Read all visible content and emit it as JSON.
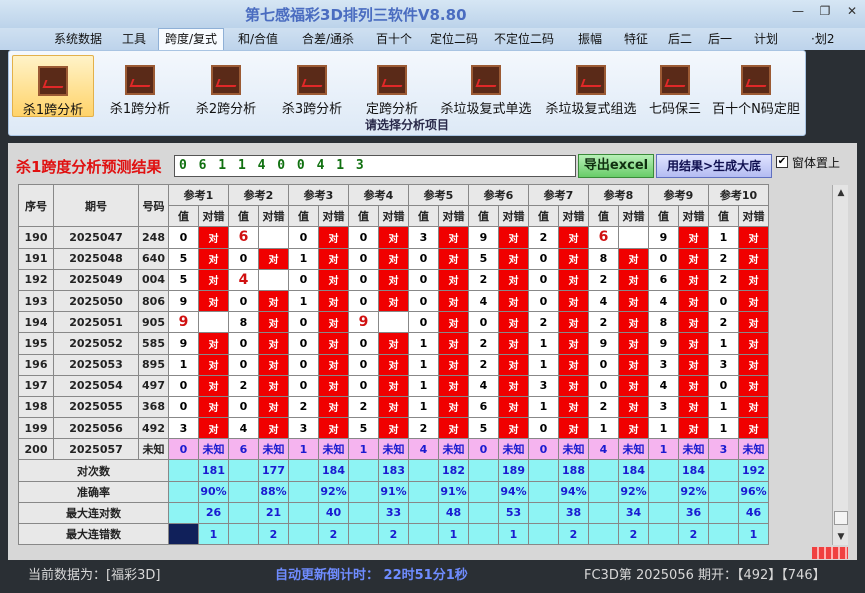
{
  "window": {
    "title": "第七感福彩3D排列三软件V8.80",
    "minimize": "—",
    "restore": "❐",
    "close": "✕"
  },
  "menu": [
    "系统数据",
    "工具",
    "跨度/复式",
    "和/合值",
    "合差/通杀",
    "百十个",
    "定位二码",
    "不定位二码",
    "振幅",
    "特征",
    "后二",
    "后一",
    "计划",
    "·划2"
  ],
  "active_menu": 2,
  "ribbon": {
    "buttons": [
      "杀1跨分析",
      "杀1跨分析",
      "杀2跨分析",
      "杀3跨分析",
      "定跨分析",
      "杀垃圾复式单选",
      "杀垃圾复式组选",
      "七码保三",
      "百十个N码定胆"
    ],
    "active": 0,
    "caption": "请选择分析项目"
  },
  "panel": {
    "title": "杀1跨度分析预测结果",
    "result": "0 6 1 1 4 0 0 4 1 3",
    "export": "导出excel",
    "generate": "用结果>生成大底",
    "pin_label": "窗体置上",
    "pin_checked": "✔"
  },
  "table": {
    "headers": {
      "seq": "序号",
      "issue": "期号",
      "code": "号码",
      "value": "值",
      "check": "对错"
    },
    "refs": [
      "参考1",
      "参考2",
      "参考3",
      "参考4",
      "参考5",
      "参考6",
      "参考7",
      "参考8",
      "参考9",
      "参考10"
    ],
    "rows": [
      {
        "seq": "190",
        "issue": "2025047",
        "code": "248",
        "vals": [
          "0",
          "6",
          "0",
          "0",
          "3",
          "9",
          "2",
          "6",
          "9",
          "1"
        ],
        "ok": [
          1,
          0,
          1,
          1,
          1,
          1,
          1,
          0,
          1,
          1
        ]
      },
      {
        "seq": "191",
        "issue": "2025048",
        "code": "640",
        "vals": [
          "5",
          "0",
          "1",
          "0",
          "0",
          "5",
          "0",
          "8",
          "0",
          "2"
        ],
        "ok": [
          1,
          1,
          1,
          1,
          1,
          1,
          1,
          1,
          1,
          1
        ]
      },
      {
        "seq": "192",
        "issue": "2025049",
        "code": "004",
        "vals": [
          "5",
          "4",
          "0",
          "0",
          "0",
          "2",
          "0",
          "2",
          "6",
          "2"
        ],
        "ok": [
          1,
          0,
          1,
          1,
          1,
          1,
          1,
          1,
          1,
          1
        ]
      },
      {
        "seq": "193",
        "issue": "2025050",
        "code": "806",
        "vals": [
          "9",
          "0",
          "1",
          "0",
          "0",
          "4",
          "0",
          "4",
          "4",
          "0"
        ],
        "ok": [
          1,
          1,
          1,
          1,
          1,
          1,
          1,
          1,
          1,
          1
        ]
      },
      {
        "seq": "194",
        "issue": "2025051",
        "code": "905",
        "vals": [
          "9",
          "8",
          "0",
          "9",
          "0",
          "0",
          "2",
          "2",
          "8",
          "2"
        ],
        "ok": [
          0,
          1,
          1,
          0,
          1,
          1,
          1,
          1,
          1,
          1
        ]
      },
      {
        "seq": "195",
        "issue": "2025052",
        "code": "585",
        "vals": [
          "9",
          "0",
          "0",
          "0",
          "1",
          "2",
          "1",
          "9",
          "9",
          "1"
        ],
        "ok": [
          1,
          1,
          1,
          1,
          1,
          1,
          1,
          1,
          1,
          1
        ]
      },
      {
        "seq": "196",
        "issue": "2025053",
        "code": "895",
        "vals": [
          "1",
          "0",
          "0",
          "0",
          "1",
          "2",
          "1",
          "0",
          "3",
          "3"
        ],
        "ok": [
          1,
          1,
          1,
          1,
          1,
          1,
          1,
          1,
          1,
          1
        ]
      },
      {
        "seq": "197",
        "issue": "2025054",
        "code": "497",
        "vals": [
          "0",
          "2",
          "0",
          "0",
          "1",
          "4",
          "3",
          "0",
          "4",
          "0"
        ],
        "ok": [
          1,
          1,
          1,
          1,
          1,
          1,
          1,
          1,
          1,
          1
        ]
      },
      {
        "seq": "198",
        "issue": "2025055",
        "code": "368",
        "vals": [
          "0",
          "0",
          "2",
          "2",
          "1",
          "6",
          "1",
          "2",
          "3",
          "1"
        ],
        "ok": [
          1,
          1,
          1,
          1,
          1,
          1,
          1,
          1,
          1,
          1
        ]
      },
      {
        "seq": "199",
        "issue": "2025056",
        "code": "492",
        "vals": [
          "3",
          "4",
          "3",
          "5",
          "2",
          "5",
          "0",
          "1",
          "1",
          "1"
        ],
        "ok": [
          1,
          1,
          1,
          1,
          1,
          1,
          1,
          1,
          1,
          1
        ]
      }
    ],
    "pending": {
      "seq": "200",
      "issue": "2025057",
      "code": "未知",
      "vals": [
        "0",
        "6",
        "1",
        "1",
        "4",
        "0",
        "0",
        "4",
        "1",
        "3"
      ],
      "status": "未知"
    },
    "ok_text": "对",
    "stats": [
      {
        "label": "对次数",
        "vals": [
          "181",
          "177",
          "184",
          "183",
          "182",
          "189",
          "188",
          "184",
          "184",
          "192"
        ]
      },
      {
        "label": "准确率",
        "vals": [
          "90%",
          "88%",
          "92%",
          "91%",
          "91%",
          "94%",
          "94%",
          "92%",
          "92%",
          "96%"
        ]
      },
      {
        "label": "最大连对数",
        "vals": [
          "26",
          "21",
          "40",
          "33",
          "48",
          "53",
          "38",
          "34",
          "36",
          "46"
        ]
      },
      {
        "label": "最大连错数",
        "vals": [
          "1",
          "2",
          "2",
          "2",
          "1",
          "1",
          "2",
          "2",
          "2",
          "1"
        ]
      }
    ]
  },
  "status": {
    "current": "当前数据为：[福彩3D]",
    "countdown": "自动更新倒计时： 22时51分1秒",
    "draw": "FC3D第 2025056 期开：【492】【746】"
  }
}
